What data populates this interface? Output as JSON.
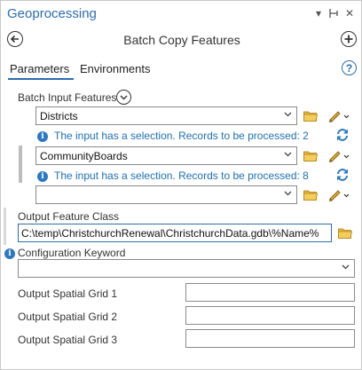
{
  "window": {
    "title": "Geoprocessing",
    "controls": {
      "dropdown": "▾",
      "pin": "⊣",
      "close": "✕"
    }
  },
  "tool": {
    "name": "Batch Copy Features",
    "back_icon": "back-arrow-icon",
    "add_icon": "add-icon"
  },
  "tabs": [
    {
      "label": "Parameters",
      "active": true
    },
    {
      "label": "Environments",
      "active": false
    }
  ],
  "help_label": "?",
  "batch_input": {
    "label": "Batch Input Features",
    "rows": [
      {
        "value": "Districts",
        "info": "The input has a selection. Records to be processed: 2"
      },
      {
        "value": "CommunityBoards",
        "info": "The input has a selection. Records to be processed: 8"
      },
      {
        "value": "",
        "info": ""
      }
    ]
  },
  "output_feature_class": {
    "label": "Output Feature Class",
    "value": "C:\\temp\\ChristchurchRenewal\\ChristchurchData.gdb\\%Name%"
  },
  "configuration_keyword": {
    "label": "Configuration Keyword",
    "value": ""
  },
  "spatial_grids": [
    {
      "label": "Output Spatial Grid 1",
      "value": ""
    },
    {
      "label": "Output Spatial Grid 2",
      "value": ""
    },
    {
      "label": "Output Spatial Grid 3",
      "value": ""
    }
  ],
  "colors": {
    "accent": "#2b6cb0",
    "info_text": "#1f6fb5",
    "folder": "#e8b43a",
    "pencil": "#d4a017"
  }
}
